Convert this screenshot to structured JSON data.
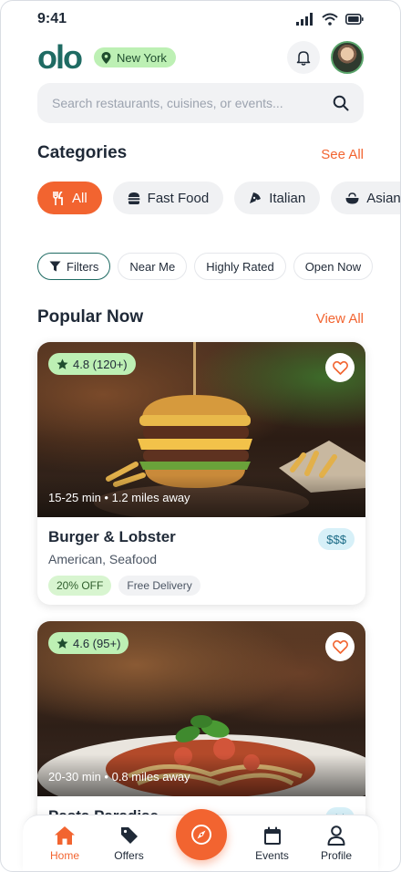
{
  "status_bar": {
    "time": "9:41"
  },
  "header": {
    "logo": "olo",
    "location": "New York"
  },
  "search": {
    "placeholder": "Search restaurants, cuisines, or events..."
  },
  "categories": {
    "title": "Categories",
    "see_all": "See All",
    "items": [
      {
        "label": "All",
        "icon": "utensils-icon"
      },
      {
        "label": "Fast Food",
        "icon": "burger-icon"
      },
      {
        "label": "Italian",
        "icon": "pizza-icon"
      },
      {
        "label": "Asian",
        "icon": "bowl-icon"
      }
    ]
  },
  "filters": [
    "Filters",
    "Near Me",
    "Highly Rated",
    "Open Now"
  ],
  "popular": {
    "title": "Popular Now",
    "view_all": "View All",
    "cards": [
      {
        "rating": "4.8 (120+)",
        "meta": "15-25 min • 1.2 miles away",
        "name": "Burger & Lobster",
        "cuisine": "American, Seafood",
        "price": "$$$",
        "tags": [
          "20% OFF",
          "Free Delivery"
        ]
      },
      {
        "rating": "4.6 (95+)",
        "meta": "20-30 min • 0.8 miles away",
        "name": "Pasta Paradise",
        "price": "$$"
      }
    ]
  },
  "tabbar": {
    "home": "Home",
    "offers": "Offers",
    "events": "Events",
    "profile": "Profile"
  },
  "colors": {
    "accent": "#f26430",
    "brand": "#1f6b63",
    "badge_green": "#bdf0b4"
  }
}
